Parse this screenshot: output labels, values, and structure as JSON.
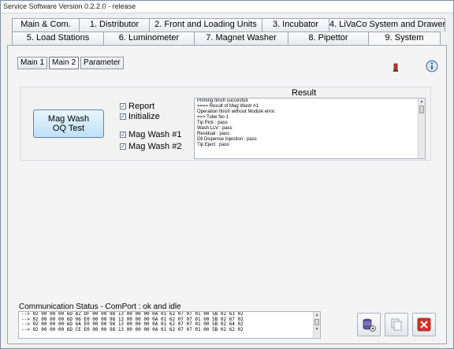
{
  "window": {
    "title": "Service Software Version 0.2.2.0 - release"
  },
  "tabs_row1": [
    {
      "label": "Main & Com."
    },
    {
      "label": "1. Distributor"
    },
    {
      "label": "2. Front and Loading Units"
    },
    {
      "label": "3. Incubator"
    },
    {
      "label": "4. LiVaCo System and Drawer"
    }
  ],
  "tabs_row2": [
    {
      "label": "5. Load Stations"
    },
    {
      "label": "6. Luminometer"
    },
    {
      "label": "7. Magnet Washer"
    },
    {
      "label": "8. Pipettor"
    },
    {
      "label": "9. System"
    }
  ],
  "subtabs": [
    {
      "label": "Main 1"
    },
    {
      "label": "Main 2"
    },
    {
      "label": "Parameter"
    }
  ],
  "mag_wash": {
    "button_line1": "Mag Wash",
    "button_line2": "OQ Test",
    "checks": [
      {
        "label": "Report",
        "checked": true
      },
      {
        "label": "Initialize",
        "checked": true
      },
      {
        "label": "Mag Wash #1",
        "checked": true
      },
      {
        "label": "Mag Wash #2",
        "checked": true
      }
    ]
  },
  "result": {
    "label": "Result",
    "lines": [
      "Priming finish succesfull.",
      "==== Result of Mag Wash #1",
      "Operation finish without Module error.",
      "==> Tube No 1",
      "Tip Pick : pass",
      "Wash LLV : pass",
      "Residual : pass",
      "Oil Dispense Injection : pass",
      "Tip Eject : pass"
    ]
  },
  "communication": {
    "status": "Communication Status - ComPort : ok and idle",
    "lines": [
      "--> 02 00 00 00 6D A2 DF 00 00 98 13 00 00 00 0A 01 62 07 07 01 00 5B 02 63 02",
      "--> 02 00 00 00 6D 06 E0 00 00 98 13 00 00 00 0A 01 62 07 07 01 00 5B 02 67 02",
      "--> 02 00 00 00 6D 6A E0 00 00 98 13 00 00 00 0A 01 62 07 07 01 00 5B 02 64 02",
      "--> 02 00 00 00 6D CE E0 00 00 98 13 00 00 00 0A 01 62 07 07 01 00 5B 02 62 02"
    ]
  },
  "colors": {
    "accent": "#5d86ad",
    "close": "#d9302a"
  }
}
